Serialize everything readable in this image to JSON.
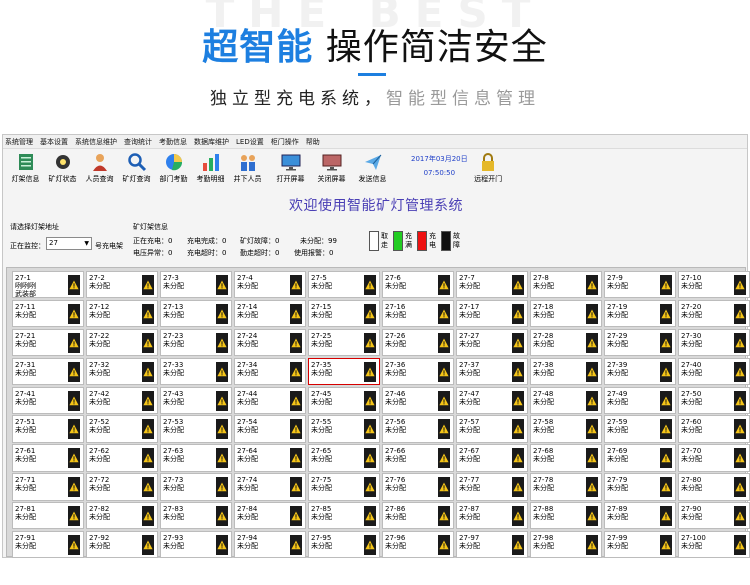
{
  "promo": {
    "watermark": "THE BEST",
    "headline_blue": "超智能",
    "headline_rest": "操作简洁安全",
    "sub_black": "独立型充电系统，",
    "sub_gray": "智能型信息管理"
  },
  "menu": [
    "系统管理",
    "基本设置",
    "系统信息维护",
    "查询统计",
    "考勤信息",
    "数据库维护",
    "LED设置",
    "柜门操作",
    "帮助"
  ],
  "toolbar": [
    {
      "label": "灯架信息",
      "icon": "rack-icon"
    },
    {
      "label": "矿灯状态",
      "icon": "headlamp-icon"
    },
    {
      "label": "人员查询",
      "icon": "person-icon"
    },
    {
      "label": "矿灯查询",
      "icon": "magnifier-icon"
    },
    {
      "label": "部门考勤",
      "icon": "pie-chart-icon"
    },
    {
      "label": "考勤明细",
      "icon": "bar-chart-icon"
    },
    {
      "label": "井下人员",
      "icon": "people-icon"
    },
    {
      "label": "打开屏幕",
      "icon": "monitor-icon"
    },
    {
      "label": "关闭屏幕",
      "icon": "monitor-off-icon"
    },
    {
      "label": "发送信息",
      "icon": "send-icon"
    },
    {
      "label": "远程开门",
      "icon": "lock-icon"
    }
  ],
  "datetime": {
    "date": "2017年03月20日",
    "time": "07:50:50"
  },
  "welcome": "欢迎使用智能矿灯管理系统",
  "address": {
    "title": "请选择灯架地址",
    "label": "正在监控：",
    "value": "27",
    "unit": "号充电架"
  },
  "rack_info": {
    "title": "矿灯架信息",
    "charging": "正在充电：0",
    "charge_done": "充电完成：0",
    "lamp_error": "矿灯故障：0",
    "unassigned": "未分配：99",
    "voltage_error": "电压异常：0",
    "charge_timeout": "充电超时：0",
    "leave_timeout": "勤走超时：0",
    "alarm": "使用报警：0"
  },
  "legend": [
    {
      "label": "取走",
      "color": "#ffffff"
    },
    {
      "label": "充满",
      "color": "#22cc22"
    },
    {
      "label": "充电",
      "color": "#ee1111"
    },
    {
      "label": "故障",
      "color": "#111111"
    }
  ],
  "lamps": [
    {
      "id": "27-1",
      "status": "咧咧咧 武装部"
    },
    {
      "id": "27-2",
      "status": "未分配"
    },
    {
      "id": "27-3",
      "status": "未分配"
    },
    {
      "id": "27-4",
      "status": "未分配"
    },
    {
      "id": "27-5",
      "status": "未分配"
    },
    {
      "id": "27-6",
      "status": "未分配"
    },
    {
      "id": "27-7",
      "status": "未分配"
    },
    {
      "id": "27-8",
      "status": "未分配"
    },
    {
      "id": "27-9",
      "status": "未分配"
    },
    {
      "id": "27-10",
      "status": "未分配"
    },
    {
      "id": "27-11",
      "status": "未分配"
    },
    {
      "id": "27-12",
      "status": "未分配"
    },
    {
      "id": "27-13",
      "status": "未分配"
    },
    {
      "id": "27-14",
      "status": "未分配"
    },
    {
      "id": "27-15",
      "status": "未分配"
    },
    {
      "id": "27-16",
      "status": "未分配"
    },
    {
      "id": "27-17",
      "status": "未分配"
    },
    {
      "id": "27-18",
      "status": "未分配"
    },
    {
      "id": "27-19",
      "status": "未分配"
    },
    {
      "id": "27-20",
      "status": "未分配"
    },
    {
      "id": "27-21",
      "status": "未分配"
    },
    {
      "id": "27-22",
      "status": "未分配"
    },
    {
      "id": "27-23",
      "status": "未分配"
    },
    {
      "id": "27-24",
      "status": "未分配"
    },
    {
      "id": "27-25",
      "status": "未分配"
    },
    {
      "id": "27-26",
      "status": "未分配"
    },
    {
      "id": "27-27",
      "status": "未分配"
    },
    {
      "id": "27-28",
      "status": "未分配"
    },
    {
      "id": "27-29",
      "status": "未分配"
    },
    {
      "id": "27-30",
      "status": "未分配"
    },
    {
      "id": "27-31",
      "status": "未分配"
    },
    {
      "id": "27-32",
      "status": "未分配"
    },
    {
      "id": "27-33",
      "status": "未分配"
    },
    {
      "id": "27-34",
      "status": "未分配"
    },
    {
      "id": "27-35",
      "status": "未分配",
      "selected": true
    },
    {
      "id": "27-36",
      "status": "未分配"
    },
    {
      "id": "27-37",
      "status": "未分配"
    },
    {
      "id": "27-38",
      "status": "未分配"
    },
    {
      "id": "27-39",
      "status": "未分配"
    },
    {
      "id": "27-40",
      "status": "未分配"
    },
    {
      "id": "27-41",
      "status": "未分配"
    },
    {
      "id": "27-42",
      "status": "未分配"
    },
    {
      "id": "27-43",
      "status": "未分配"
    },
    {
      "id": "27-44",
      "status": "未分配"
    },
    {
      "id": "27-45",
      "status": "未分配"
    },
    {
      "id": "27-46",
      "status": "未分配"
    },
    {
      "id": "27-47",
      "status": "未分配"
    },
    {
      "id": "27-48",
      "status": "未分配"
    },
    {
      "id": "27-49",
      "status": "未分配"
    },
    {
      "id": "27-50",
      "status": "未分配"
    },
    {
      "id": "27-51",
      "status": "未分配"
    },
    {
      "id": "27-52",
      "status": "未分配"
    },
    {
      "id": "27-53",
      "status": "未分配"
    },
    {
      "id": "27-54",
      "status": "未分配"
    },
    {
      "id": "27-55",
      "status": "未分配"
    },
    {
      "id": "27-56",
      "status": "未分配"
    },
    {
      "id": "27-57",
      "status": "未分配"
    },
    {
      "id": "27-58",
      "status": "未分配"
    },
    {
      "id": "27-59",
      "status": "未分配"
    },
    {
      "id": "27-60",
      "status": "未分配"
    },
    {
      "id": "27-61",
      "status": "未分配"
    },
    {
      "id": "27-62",
      "status": "未分配"
    },
    {
      "id": "27-63",
      "status": "未分配"
    },
    {
      "id": "27-64",
      "status": "未分配"
    },
    {
      "id": "27-65",
      "status": "未分配"
    },
    {
      "id": "27-66",
      "status": "未分配"
    },
    {
      "id": "27-67",
      "status": "未分配"
    },
    {
      "id": "27-68",
      "status": "未分配"
    },
    {
      "id": "27-69",
      "status": "未分配"
    },
    {
      "id": "27-70",
      "status": "未分配"
    },
    {
      "id": "27-71",
      "status": "未分配"
    },
    {
      "id": "27-72",
      "status": "未分配"
    },
    {
      "id": "27-73",
      "status": "未分配"
    },
    {
      "id": "27-74",
      "status": "未分配"
    },
    {
      "id": "27-75",
      "status": "未分配"
    },
    {
      "id": "27-76",
      "status": "未分配"
    },
    {
      "id": "27-77",
      "status": "未分配"
    },
    {
      "id": "27-78",
      "status": "未分配"
    },
    {
      "id": "27-79",
      "status": "未分配"
    },
    {
      "id": "27-80",
      "status": "未分配"
    },
    {
      "id": "27-81",
      "status": "未分配"
    },
    {
      "id": "27-82",
      "status": "未分配"
    },
    {
      "id": "27-83",
      "status": "未分配"
    },
    {
      "id": "27-84",
      "status": "未分配"
    },
    {
      "id": "27-85",
      "status": "未分配"
    },
    {
      "id": "27-86",
      "status": "未分配"
    },
    {
      "id": "27-87",
      "status": "未分配"
    },
    {
      "id": "27-88",
      "status": "未分配"
    },
    {
      "id": "27-89",
      "status": "未分配"
    },
    {
      "id": "27-90",
      "status": "未分配"
    },
    {
      "id": "27-91",
      "status": "未分配"
    },
    {
      "id": "27-92",
      "status": "未分配"
    },
    {
      "id": "27-93",
      "status": "未分配"
    },
    {
      "id": "27-94",
      "status": "未分配"
    },
    {
      "id": "27-95",
      "status": "未分配"
    },
    {
      "id": "27-96",
      "status": "未分配"
    },
    {
      "id": "27-97",
      "status": "未分配"
    },
    {
      "id": "27-98",
      "status": "未分配"
    },
    {
      "id": "27-99",
      "status": "未分配"
    },
    {
      "id": "27-100",
      "status": "未分配"
    }
  ]
}
